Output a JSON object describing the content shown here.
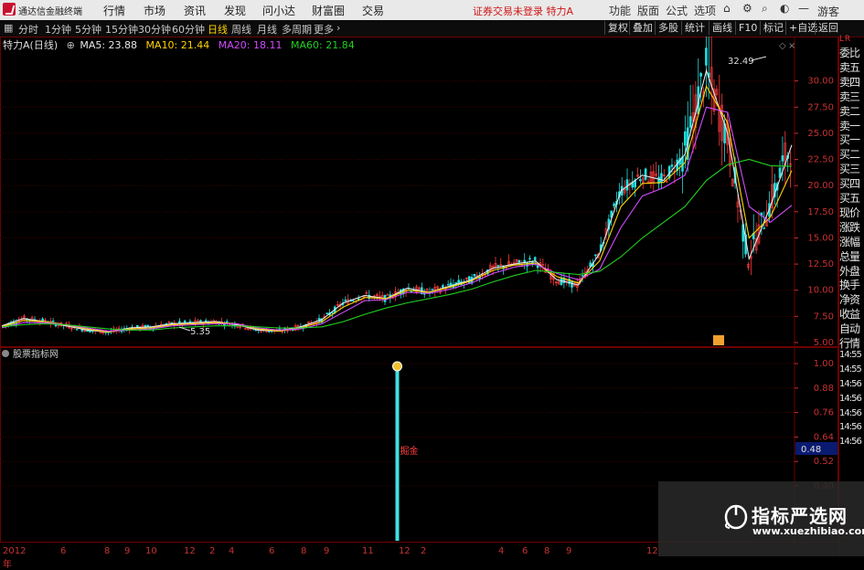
{
  "menubar": {
    "app_title": "通达信金融终端",
    "menus": [
      "行情",
      "市场",
      "资讯",
      "发现",
      "问小达",
      "财富圈",
      "交易"
    ],
    "notice": "证券交易未登录 特力A",
    "right": [
      "功能",
      "版面",
      "公式",
      "选项",
      "游客"
    ]
  },
  "toolbar": {
    "periods": [
      "分时",
      "1分钟",
      "5分钟",
      "15分钟",
      "30分钟",
      "60分钟",
      "日线",
      "周线",
      "月线",
      "多周期",
      "更多"
    ],
    "active": "日线",
    "right_buttons": [
      "复权",
      "叠加",
      "多股",
      "统计",
      "画线",
      "F10",
      "标记",
      "+自选",
      "返回"
    ]
  },
  "chart_info": {
    "name": "特力A(日线)",
    "ma5": "MA5: 23.88",
    "ma10": "MA10: 21.44",
    "ma20": "MA20: 18.11",
    "ma60": "MA60: 21.84",
    "colors": {
      "ma5": "#e6e6e6",
      "ma10": "#ffd400",
      "ma20": "#d04cff",
      "ma60": "#22d022",
      "up": "#ff3b3b",
      "down": "#22dfdf"
    }
  },
  "chart_data": [
    {
      "type": "line",
      "title": "",
      "y_ticks": [
        "30.00",
        "27.50",
        "25.00",
        "22.50",
        "20.00",
        "17.50",
        "15.00",
        "12.50",
        "10.00",
        "7.50",
        "5.00"
      ],
      "ylim": [
        5,
        32.5
      ],
      "annotations": {
        "high": "32.49",
        "low": "5.35"
      },
      "series": [
        {
          "name": "MA5",
          "color": "#e6e6e6",
          "values": [
            6.6,
            7.3,
            7.0,
            6.6,
            6.2,
            6.0,
            6.4,
            6.5,
            6.8,
            6.9,
            7.0,
            6.7,
            6.2,
            6.1,
            6.5,
            7.2,
            8.8,
            9.5,
            9.2,
            10.2,
            9.8,
            10.4,
            11.0,
            12.1,
            12.5,
            12.8,
            11.0,
            10.5,
            13.5,
            19.5,
            21.0,
            20.5,
            23.0,
            31.0,
            25.0,
            13.0,
            18.0,
            23.88
          ]
        },
        {
          "name": "MA10",
          "color": "#ffd400",
          "values": [
            6.5,
            7.1,
            7.0,
            6.7,
            6.3,
            6.0,
            6.3,
            6.4,
            6.7,
            6.8,
            6.9,
            6.8,
            6.3,
            6.1,
            6.4,
            7.0,
            8.4,
            9.3,
            9.2,
            10.0,
            9.8,
            10.3,
            10.9,
            11.9,
            12.4,
            12.6,
            11.3,
            10.7,
            12.8,
            18.0,
            20.2,
            20.3,
            22.2,
            29.5,
            26.0,
            15.0,
            17.0,
            21.44
          ]
        },
        {
          "name": "MA20",
          "color": "#d04cff",
          "values": [
            6.4,
            6.9,
            6.9,
            6.7,
            6.4,
            6.1,
            6.2,
            6.3,
            6.6,
            6.7,
            6.8,
            6.8,
            6.4,
            6.2,
            6.3,
            6.8,
            7.9,
            9.0,
            9.1,
            9.8,
            9.7,
            10.1,
            10.7,
            11.6,
            12.2,
            12.5,
            11.6,
            11.0,
            12.0,
            16.0,
            19.0,
            19.8,
            21.0,
            27.5,
            27.0,
            18.0,
            16.5,
            18.11
          ]
        },
        {
          "name": "MA60",
          "color": "#22d022",
          "values": [
            6.5,
            6.7,
            6.8,
            6.7,
            6.5,
            6.3,
            6.2,
            6.2,
            6.4,
            6.5,
            6.6,
            6.6,
            6.5,
            6.4,
            6.4,
            6.5,
            7.0,
            7.7,
            8.3,
            8.8,
            9.2,
            9.6,
            10.1,
            10.8,
            11.4,
            11.9,
            11.7,
            11.5,
            11.8,
            13.2,
            15.0,
            16.5,
            18.0,
            20.5,
            22.0,
            22.5,
            21.9,
            21.84
          ]
        }
      ]
    },
    {
      "type": "bar",
      "title": "股票指标网",
      "y_ticks": [
        "1.00",
        "0.88",
        "0.76",
        "0.64",
        "0.52",
        "0.40"
      ],
      "ylim": [
        0,
        1
      ],
      "signal": {
        "index": 0.5,
        "value": 1.0,
        "label": "掘金"
      },
      "current_value": "0.48",
      "x_ticks": [
        "2012年",
        "6",
        "8",
        "9",
        "10",
        "12",
        "2",
        "4",
        "6",
        "8",
        "9",
        "11",
        "12",
        "2",
        "4",
        "6",
        "8",
        "9",
        "12"
      ]
    }
  ],
  "sidebar": {
    "items": [
      "委比",
      "卖五",
      "卖四",
      "卖三",
      "卖二",
      "卖一",
      "买一",
      "买二",
      "买三",
      "买四",
      "买五",
      "现价",
      "涨跌",
      "涨幅",
      "总量",
      "外盘",
      "换手",
      "净资",
      "收益",
      "自动",
      "行情"
    ],
    "times": [
      "14:55",
      "14:55",
      "14:56",
      "14:56",
      "14:56",
      "14:56",
      "14:56"
    ],
    "top_mark": "L R"
  },
  "watermark": {
    "title": "指标严选网",
    "url": "www.xuezhibiao.com"
  }
}
